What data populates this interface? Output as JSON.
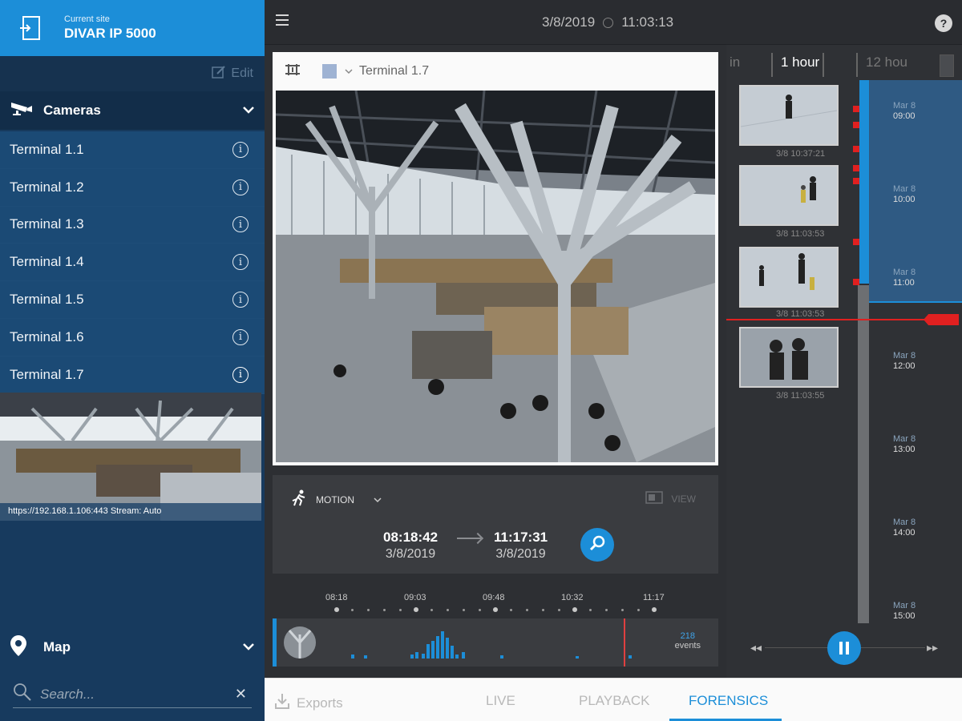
{
  "site": {
    "label": "Current site",
    "name": "DIVAR IP 5000",
    "edit_label": "Edit"
  },
  "cameras": {
    "header": "Cameras",
    "items": [
      {
        "label": "Terminal 1.1"
      },
      {
        "label": "Terminal 1.2"
      },
      {
        "label": "Terminal 1.3"
      },
      {
        "label": "Terminal 1.4"
      },
      {
        "label": "Terminal 1.5"
      },
      {
        "label": "Terminal 1.6"
      },
      {
        "label": "Terminal 1.7",
        "selected": true
      }
    ],
    "info_glyph": "i"
  },
  "preview": {
    "caption": "https://192.168.1.106:443 Stream: Auto"
  },
  "map": {
    "label": "Map"
  },
  "search": {
    "placeholder": "Search..."
  },
  "topbar": {
    "date": "3/8/2019",
    "time": "11:03:13",
    "help": "?"
  },
  "video": {
    "camera_name": "Terminal 1.7"
  },
  "motion": {
    "label": "MOTION",
    "view_label": "VIEW",
    "start_time": "08:18:42",
    "start_date": "3/8/2019",
    "end_time": "11:17:31",
    "end_date": "3/8/2019"
  },
  "timeline": {
    "labels": [
      "08:18",
      "09:03",
      "09:48",
      "10:32",
      "11:17"
    ],
    "events_count": "218",
    "events_label": "events",
    "histogram": [
      5,
      4,
      5,
      8,
      6,
      18,
      22,
      28,
      34,
      26,
      16,
      5,
      8,
      4,
      3,
      4
    ]
  },
  "zoom": {
    "left": "in",
    "active": "1 hour",
    "right": "12 hou"
  },
  "thumbnails": [
    {
      "time": "3/8 10:37:21"
    },
    {
      "time": "3/8 11:03:53"
    },
    {
      "time": "3/8 11:03:53"
    },
    {
      "time": "3/8 11:03:55"
    }
  ],
  "hours": [
    {
      "day": "Mar 8",
      "time": "09:00"
    },
    {
      "day": "Mar 8",
      "time": "10:00"
    },
    {
      "day": "Mar 8",
      "time": "11:00"
    },
    {
      "day": "Mar 8",
      "time": "12:00"
    },
    {
      "day": "Mar 8",
      "time": "13:00"
    },
    {
      "day": "Mar 8",
      "time": "14:00"
    },
    {
      "day": "Mar 8",
      "time": "15:00"
    }
  ],
  "bottom_tabs": {
    "exports": "Exports",
    "live": "LIVE",
    "playback": "PLAYBACK",
    "forensics": "FORENSICS"
  },
  "colors": {
    "accent": "#1c8ed8",
    "sidebar": "#173a5e",
    "marker": "#e02020"
  },
  "icons": [
    "exit-icon",
    "edit-icon",
    "camera-icon",
    "chevron-down-icon",
    "info-icon",
    "map-pin-icon",
    "search-icon",
    "close-icon",
    "menu-icon",
    "clock-icon",
    "help-icon",
    "motion-icon",
    "magnifier-icon",
    "pause-icon",
    "rewind-icon",
    "fast-forward-icon",
    "download-icon"
  ]
}
